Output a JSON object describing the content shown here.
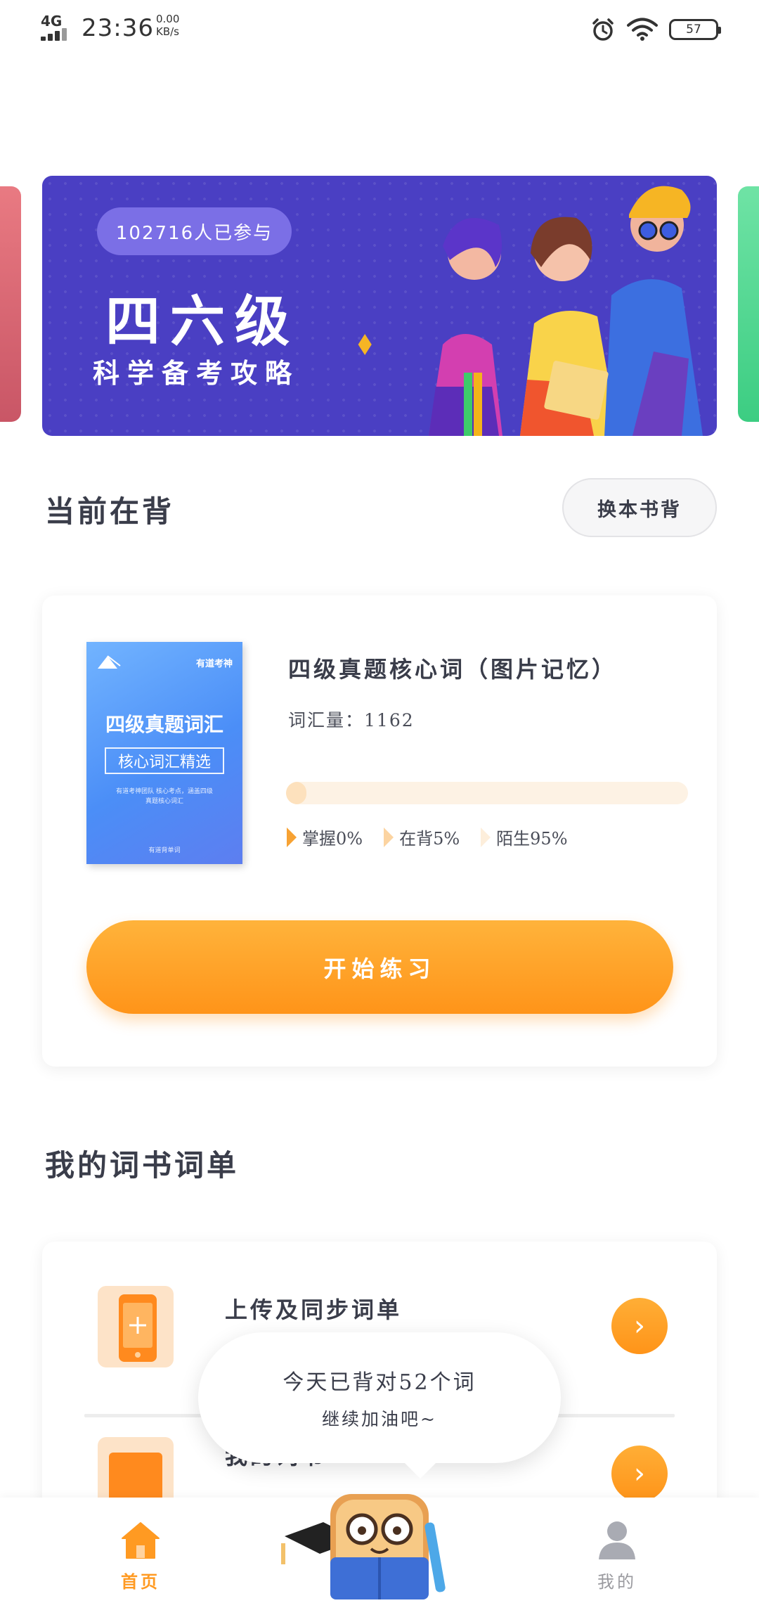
{
  "status_bar": {
    "network": "4G",
    "time": "23:36",
    "speed_value": "0.00",
    "speed_unit": "KB/s",
    "battery": "57"
  },
  "banner": {
    "participants": "102716人已参与",
    "title": "四六级",
    "subtitle": "科学备考攻略"
  },
  "current": {
    "section_title": "当前在背",
    "switch_button": "换本书背",
    "book": {
      "cover_brand": "有道考神",
      "cover_title": "四级真题词汇",
      "cover_subtitle": "核心词汇精选",
      "cover_desc_1": "有道考神团队 核心考点，涵盖四级",
      "cover_desc_2": "真题核心词汇",
      "cover_footer": "有道背单词",
      "name": "四级真题核心词（图片记忆）",
      "word_count_label": "词汇量：",
      "word_count": "1162",
      "progress_learning_pct": 5,
      "legend": {
        "mastered": "掌握0%",
        "learning": "在背5%",
        "unknown": "陌生95%"
      }
    },
    "start_button": "开始练习"
  },
  "word_lists": {
    "section_title": "我的词书词单",
    "items": [
      {
        "label": "上传及同步词单",
        "icon": "phone-upload-icon"
      },
      {
        "label": "我的词书",
        "icon": "book-icon"
      }
    ]
  },
  "toast": {
    "line1": "今天已背对52个词",
    "line2": "继续加油吧~"
  },
  "bottom_nav": {
    "home": "首页",
    "mine": "我的"
  },
  "colors": {
    "accent": "#ff9a22",
    "banner_bg": "#4a3fc3",
    "text": "#3a3d4a"
  }
}
